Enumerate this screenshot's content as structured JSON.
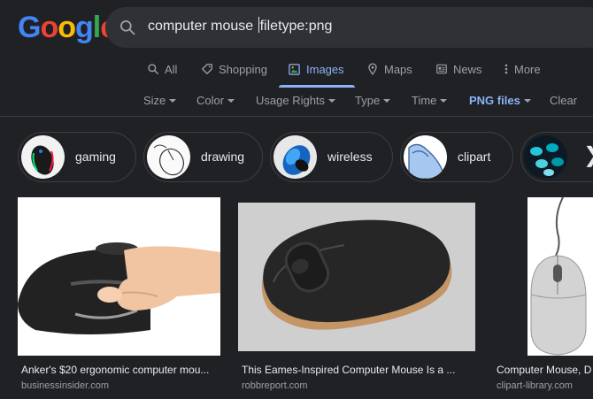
{
  "header": {
    "logo_letters": [
      "G",
      "o",
      "o",
      "g",
      "l",
      "e"
    ],
    "logo_colors": [
      "#4285f4",
      "#ea4335",
      "#fbbc05",
      "#4285f4",
      "#34a853",
      "#ea4335"
    ],
    "query_before_caret": "computer mouse ",
    "query_after_caret": "filetype:png"
  },
  "tabs": [
    {
      "label": "All",
      "icon": "search-icon"
    },
    {
      "label": "Shopping",
      "icon": "tag-icon"
    },
    {
      "label": "Images",
      "icon": "image-icon",
      "active": true
    },
    {
      "label": "Maps",
      "icon": "map-pin-icon"
    },
    {
      "label": "News",
      "icon": "newspaper-icon"
    },
    {
      "label": "More",
      "icon": "more-vert-icon"
    }
  ],
  "filters": {
    "size": "Size",
    "color": "Color",
    "usage_rights": "Usage Rights",
    "type": "Type",
    "time": "Time",
    "png_files": "PNG files",
    "clear": "Clear"
  },
  "chips": [
    {
      "label": "gaming"
    },
    {
      "label": "drawing"
    },
    {
      "label": "wireless"
    },
    {
      "label": "clipart"
    }
  ],
  "results": [
    {
      "title": "Anker's $20 ergonomic computer mou...",
      "source": "businessinsider.com"
    },
    {
      "title": "This Eames-Inspired Computer Mouse Is a ...",
      "source": "robbreport.com"
    },
    {
      "title": "Computer Mouse, D",
      "source": "clipart-library.com"
    }
  ],
  "colors": {
    "background": "#202124",
    "accent": "#8ab4f8",
    "text_primary": "#e8eaed",
    "text_secondary": "#9aa0a6"
  }
}
